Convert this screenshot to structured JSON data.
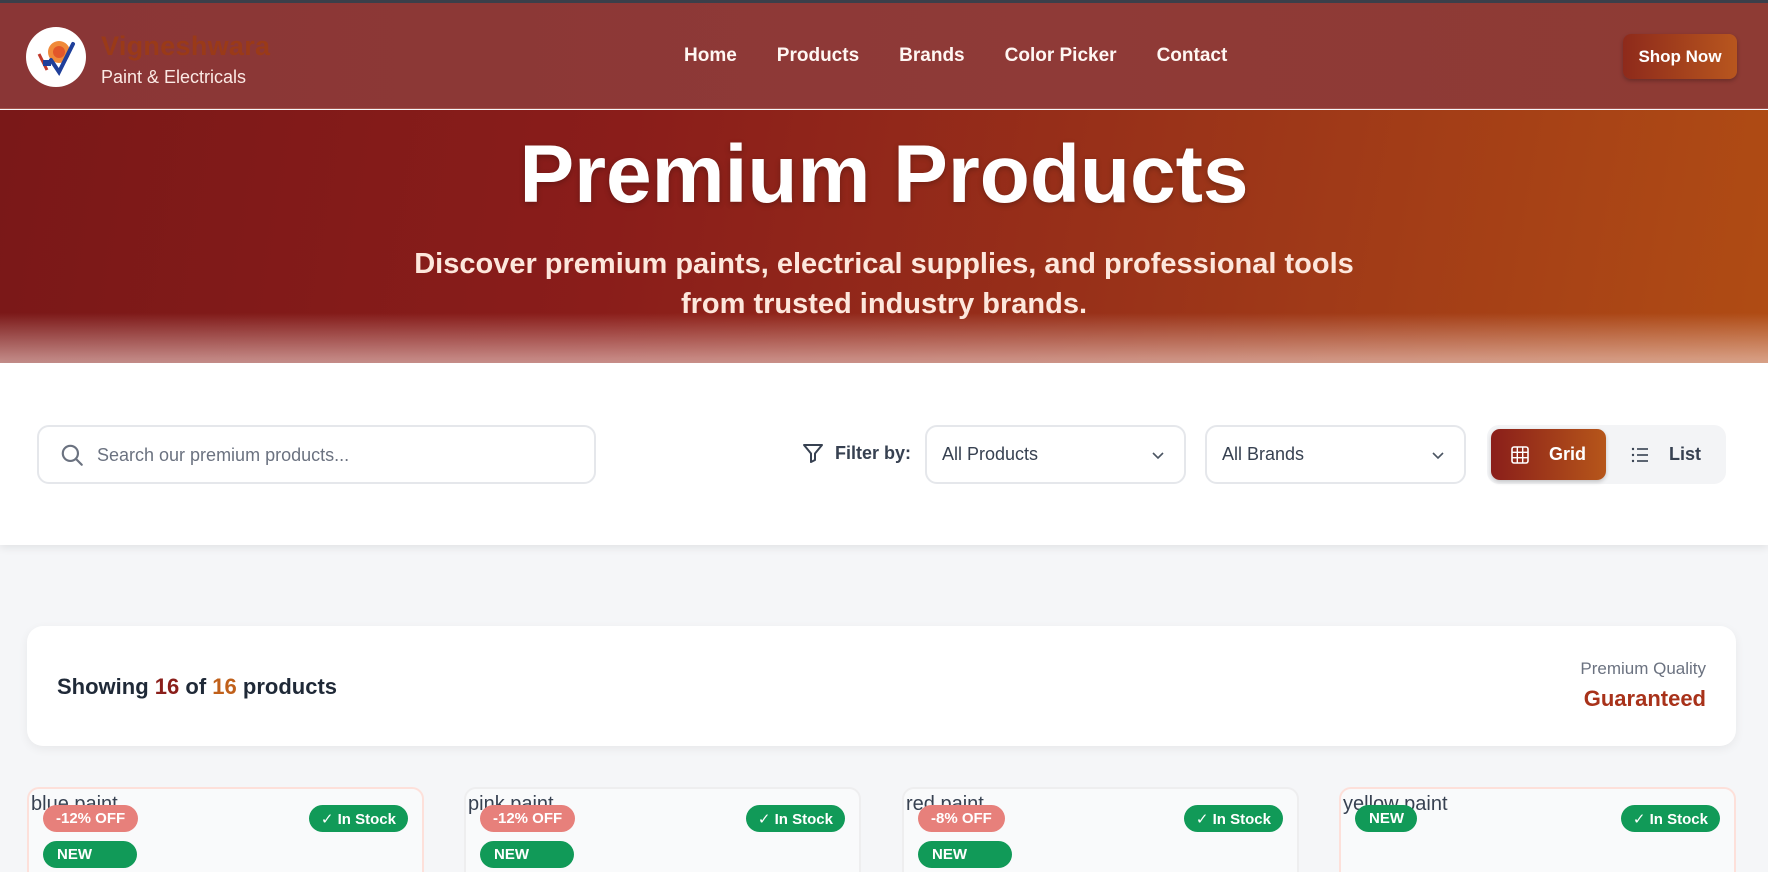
{
  "header": {
    "brand_name": "Vigneshwara",
    "brand_sub": "Paint & Electricals",
    "nav": [
      "Home",
      "Products",
      "Brands",
      "Color Picker",
      "Contact"
    ],
    "cta": "Shop Now"
  },
  "hero": {
    "title": "Premium Products",
    "subtitle": "Discover premium paints, electrical supplies, and professional tools from trusted industry brands."
  },
  "filters": {
    "search_placeholder": "Search our premium products...",
    "filter_label": "Filter by:",
    "category_selected": "All Products",
    "brand_selected": "All Brands",
    "view_grid": "Grid",
    "view_list": "List"
  },
  "summary": {
    "prefix": "Showing",
    "shown": "16",
    "of": "of",
    "total": "16",
    "suffix": "products",
    "quality_label": "Premium Quality",
    "quality_value": "Guaranteed"
  },
  "products": [
    {
      "alt": "blue paint",
      "discount": "-12% OFF",
      "new": "NEW",
      "stock": "✓ In Stock"
    },
    {
      "alt": "pink paint",
      "discount": "-12% OFF",
      "new": "NEW",
      "stock": "✓ In Stock"
    },
    {
      "alt": "red paint",
      "discount": "-8% OFF",
      "new": "NEW",
      "stock": "✓ In Stock"
    },
    {
      "alt": "yellow paint",
      "new": "NEW",
      "stock": "✓ In Stock"
    }
  ]
}
